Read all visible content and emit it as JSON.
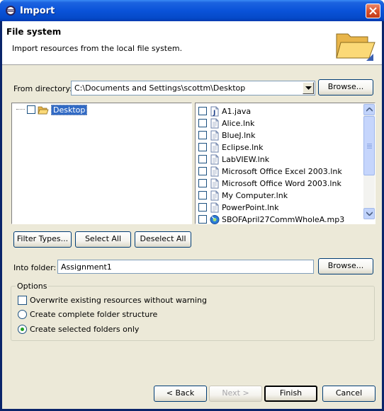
{
  "window": {
    "title": "Import"
  },
  "banner": {
    "title": "File system",
    "description": "Import resources from the local file system."
  },
  "from_directory": {
    "label": "From directory:",
    "value": "C:\\Documents and Settings\\scottm\\Desktop",
    "browse_label": "Browse..."
  },
  "tree": {
    "items": [
      {
        "label": "Desktop",
        "checked": false,
        "selected": true
      }
    ]
  },
  "files": {
    "items": [
      {
        "name": "A1.java",
        "icon": "java-file-icon"
      },
      {
        "name": "Alice.lnk",
        "icon": "file-icon"
      },
      {
        "name": "BlueJ.lnk",
        "icon": "file-icon"
      },
      {
        "name": "Eclipse.lnk",
        "icon": "file-icon"
      },
      {
        "name": "LabVIEW.lnk",
        "icon": "file-icon"
      },
      {
        "name": "Microsoft Office Excel 2003.lnk",
        "icon": "file-icon"
      },
      {
        "name": "Microsoft Office Word 2003.lnk",
        "icon": "file-icon"
      },
      {
        "name": "My Computer.lnk",
        "icon": "file-icon"
      },
      {
        "name": "PowerPoint.lnk",
        "icon": "file-icon"
      },
      {
        "name": "SBOFApril27CommWholeA.mp3",
        "icon": "media-file-icon"
      }
    ]
  },
  "selection_buttons": {
    "filter_types": "Filter Types...",
    "select_all": "Select All",
    "deselect_all": "Deselect All"
  },
  "into_folder": {
    "label": "Into folder:",
    "value": "Assignment1",
    "browse_label": "Browse..."
  },
  "options": {
    "title": "Options",
    "overwrite": {
      "label": "Overwrite existing resources without warning",
      "checked": false
    },
    "complete_structure": {
      "label": "Create complete folder structure",
      "selected": false
    },
    "selected_only": {
      "label": "Create selected folders only",
      "selected": true
    }
  },
  "footer": {
    "back": "< Back",
    "next": "Next >",
    "finish": "Finish",
    "cancel": "Cancel"
  },
  "colors": {
    "titlebar": "#0a53d9",
    "dialog_bg": "#ece9d8",
    "selection": "#316ac5"
  }
}
